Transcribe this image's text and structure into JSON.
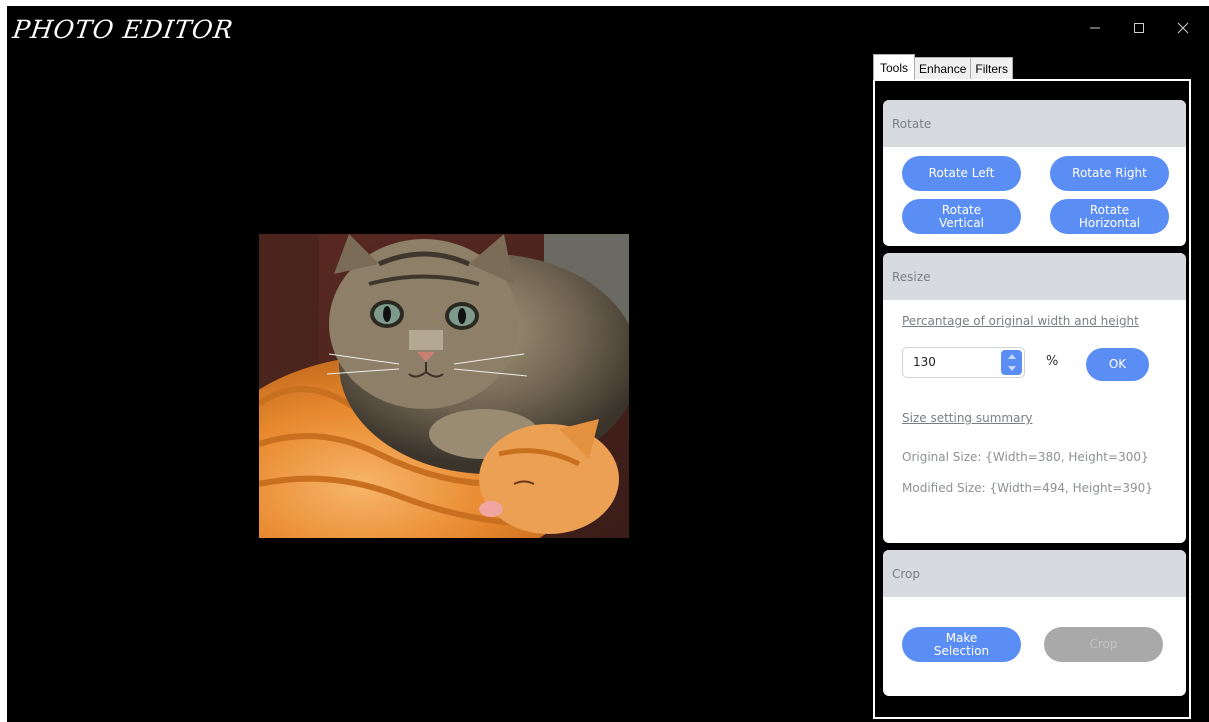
{
  "app": {
    "title": "PHOTO EDITOR"
  },
  "window_controls": {
    "minimize_icon": "minimize-icon",
    "maximize_icon": "maximize-icon",
    "close_icon": "close-icon"
  },
  "tabs": [
    {
      "label": "Tools",
      "active": true
    },
    {
      "label": "Enhance",
      "active": false
    },
    {
      "label": "Filters",
      "active": false
    }
  ],
  "rotate": {
    "header": "Rotate",
    "rotate_left": "Rotate Left",
    "rotate_right": "Rotate Right",
    "rotate_vertical": "Rotate\nVertical",
    "rotate_horizontal": "Rotate\nHorizontal"
  },
  "resize": {
    "header": "Resize",
    "percentage_label": "Percantage of original width and height",
    "percentage_value": "130",
    "unit": "%",
    "ok_label": "OK",
    "summary_label": "Size setting summary",
    "original_size": "Original Size:   {Width=380, Height=300}",
    "modified_size": "Modified Size:  {Width=494, Height=390}"
  },
  "crop": {
    "header": "Crop",
    "make_selection": "Make\nSelection",
    "crop_label": "Crop"
  },
  "colors": {
    "accent": "#5b8ef4",
    "disabled": "#a9a9a9",
    "canvas_bg": "#000000",
    "group_header": "#d7dade"
  }
}
